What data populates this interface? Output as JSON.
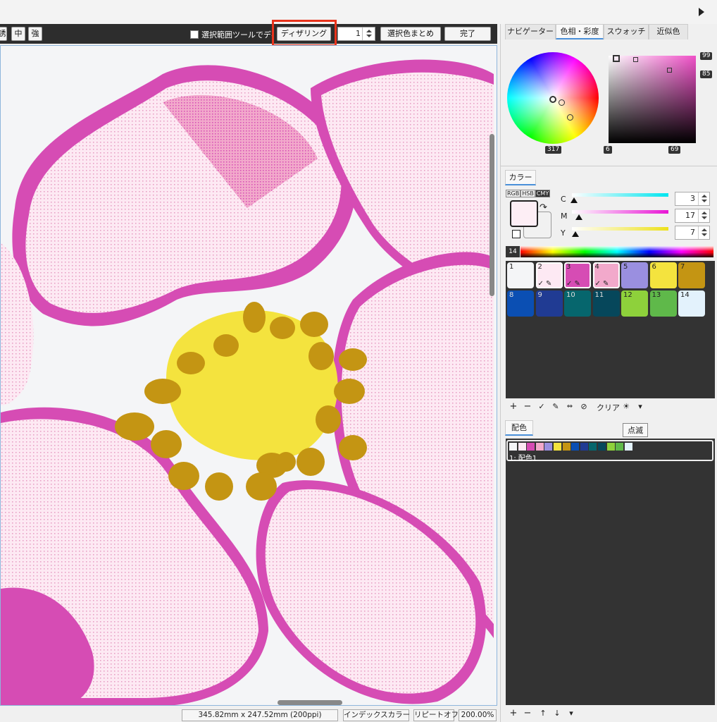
{
  "toolbar": {
    "btn_left1": "誘",
    "btn_mid": "中",
    "btn_strong": "強",
    "checkbox_label": "選択範囲ツールでディザ",
    "dithering_button": "ディザリング",
    "spinner_value": "1",
    "merge_button": "選択色まとめ",
    "done_button": "完了"
  },
  "panel_tabs": [
    "ナビゲーター",
    "色相・彩度",
    "スウォッチ",
    "近似色"
  ],
  "color_wheel": {
    "hue_label": "317",
    "top_right_label": "99",
    "right_label": "85",
    "bottom_left_label": "6",
    "bottom_right_label": "69"
  },
  "color_panel": {
    "tab": "カラー",
    "modes": [
      "RGB",
      "HSB",
      "CMY"
    ],
    "sliders": [
      {
        "label": "C",
        "value": "3"
      },
      {
        "label": "M",
        "value": "17"
      },
      {
        "label": "Y",
        "value": "7"
      }
    ],
    "spectrum_label": "14",
    "main_color": "#fdeef5",
    "sub_color": "#f1f1f1"
  },
  "palette": [
    {
      "n": "1",
      "color": "#f4f5f7",
      "mark": ""
    },
    {
      "n": "2",
      "color": "#fde9f3",
      "mark": "✓ ✎"
    },
    {
      "n": "3",
      "color": "#d64cb4",
      "mark": "✓ ✎"
    },
    {
      "n": "4",
      "color": "#f2a9cb",
      "mark": "✓ ✎"
    },
    {
      "n": "5",
      "color": "#9a8fe0",
      "mark": ""
    },
    {
      "n": "6",
      "color": "#f4e33e",
      "mark": ""
    },
    {
      "n": "7",
      "color": "#c49513",
      "mark": ""
    },
    {
      "n": "8",
      "color": "#0b4fb3",
      "mark": ""
    },
    {
      "n": "9",
      "color": "#203b93",
      "mark": ""
    },
    {
      "n": "10",
      "color": "#06666d",
      "mark": ""
    },
    {
      "n": "11",
      "color": "#06475b",
      "mark": ""
    },
    {
      "n": "12",
      "color": "#8ed13b",
      "mark": ""
    },
    {
      "n": "13",
      "color": "#5fb94a",
      "mark": ""
    },
    {
      "n": "14",
      "color": "#e3f2fc",
      "mark": ""
    }
  ],
  "palette_tools": {
    "add": "+",
    "remove": "−",
    "check": "✓",
    "edit": "✎",
    "swap": "⇔",
    "forbid": "⊘",
    "clear": "クリア",
    "blink": "☀",
    "menu": "▾"
  },
  "tooltip": "点滅",
  "scheme_panel": {
    "tab": "配色",
    "item_label": "1: 配色1",
    "tools": [
      "+",
      "−",
      "↑",
      "↓",
      "▾"
    ]
  },
  "statusbar": {
    "size": "345.82mm x 247.52mm (200ppi)",
    "mode": "インデックスカラー",
    "repeat": "リピートオフ",
    "zoom": "200.00%"
  }
}
